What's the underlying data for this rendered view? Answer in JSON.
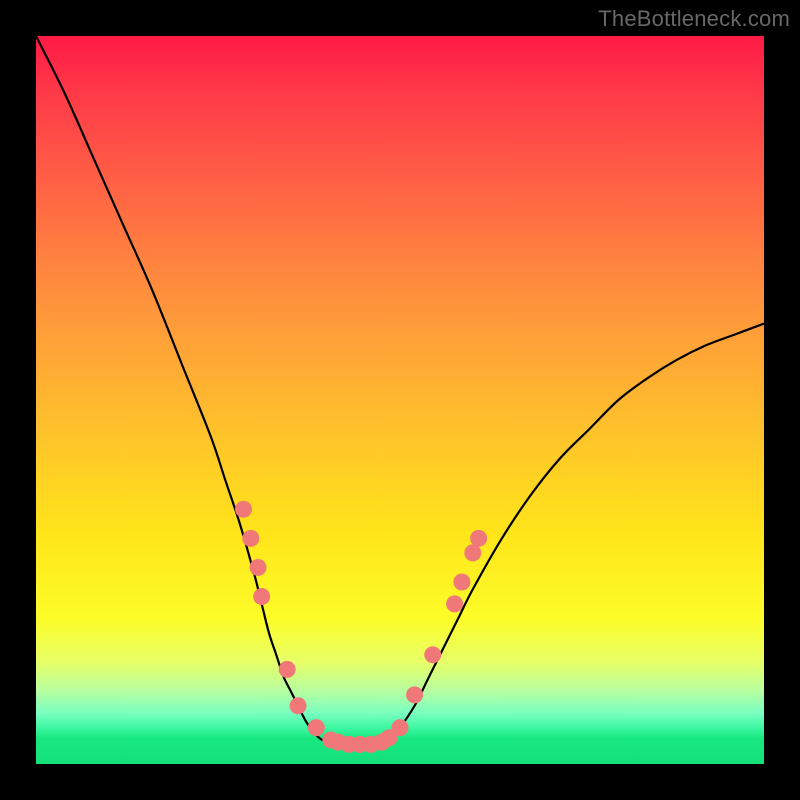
{
  "watermark": "TheBottleneck.com",
  "colors": {
    "frame": "#000000",
    "curve": "#000000",
    "dot_fill": "#f07878",
    "dot_stroke": "#c05050",
    "gradient_top": "#ff1a46",
    "gradient_bottom": "#14e07a"
  },
  "chart_data": {
    "type": "line",
    "title": "",
    "xlabel": "",
    "ylabel": "",
    "xlim": [
      0,
      100
    ],
    "ylim": [
      0,
      100
    ],
    "grid": false,
    "curve_left": {
      "x": [
        0,
        4,
        8,
        12,
        16,
        20,
        24,
        26,
        28,
        30,
        31,
        32,
        33,
        34,
        35,
        36,
        37,
        38,
        39,
        40
      ],
      "y": [
        100,
        92,
        83,
        74,
        65,
        55,
        45,
        39,
        33,
        26,
        22,
        18,
        15,
        12,
        10,
        8,
        6,
        4.5,
        3.5,
        3
      ]
    },
    "curve_flat": {
      "x": [
        40,
        41,
        42,
        43,
        44,
        45,
        46,
        47,
        48
      ],
      "y": [
        3,
        2.7,
        2.5,
        2.3,
        2.3,
        2.3,
        2.5,
        2.7,
        3
      ]
    },
    "curve_right": {
      "x": [
        48,
        49,
        50,
        52,
        54,
        56,
        58,
        60,
        64,
        68,
        72,
        76,
        80,
        84,
        88,
        92,
        96,
        100
      ],
      "y": [
        3,
        4,
        5,
        8,
        12,
        16,
        20,
        24,
        31,
        37,
        42,
        46,
        50,
        53,
        55.5,
        57.5,
        59,
        60.5
      ]
    },
    "dots": [
      {
        "x": 28.5,
        "y": 35
      },
      {
        "x": 29.5,
        "y": 31
      },
      {
        "x": 30.5,
        "y": 27
      },
      {
        "x": 31.0,
        "y": 23
      },
      {
        "x": 34.5,
        "y": 13
      },
      {
        "x": 36.0,
        "y": 8
      },
      {
        "x": 38.5,
        "y": 5
      },
      {
        "x": 40.5,
        "y": 3.3
      },
      {
        "x": 41.5,
        "y": 3.0
      },
      {
        "x": 43.0,
        "y": 2.7
      },
      {
        "x": 44.5,
        "y": 2.7
      },
      {
        "x": 46.0,
        "y": 2.7
      },
      {
        "x": 47.5,
        "y": 3.0
      },
      {
        "x": 48.5,
        "y": 3.6
      },
      {
        "x": 50.0,
        "y": 5.0
      },
      {
        "x": 52.0,
        "y": 9.5
      },
      {
        "x": 54.5,
        "y": 15
      },
      {
        "x": 57.5,
        "y": 22
      },
      {
        "x": 58.5,
        "y": 25
      },
      {
        "x": 60.0,
        "y": 29
      },
      {
        "x": 60.8,
        "y": 31
      }
    ]
  }
}
